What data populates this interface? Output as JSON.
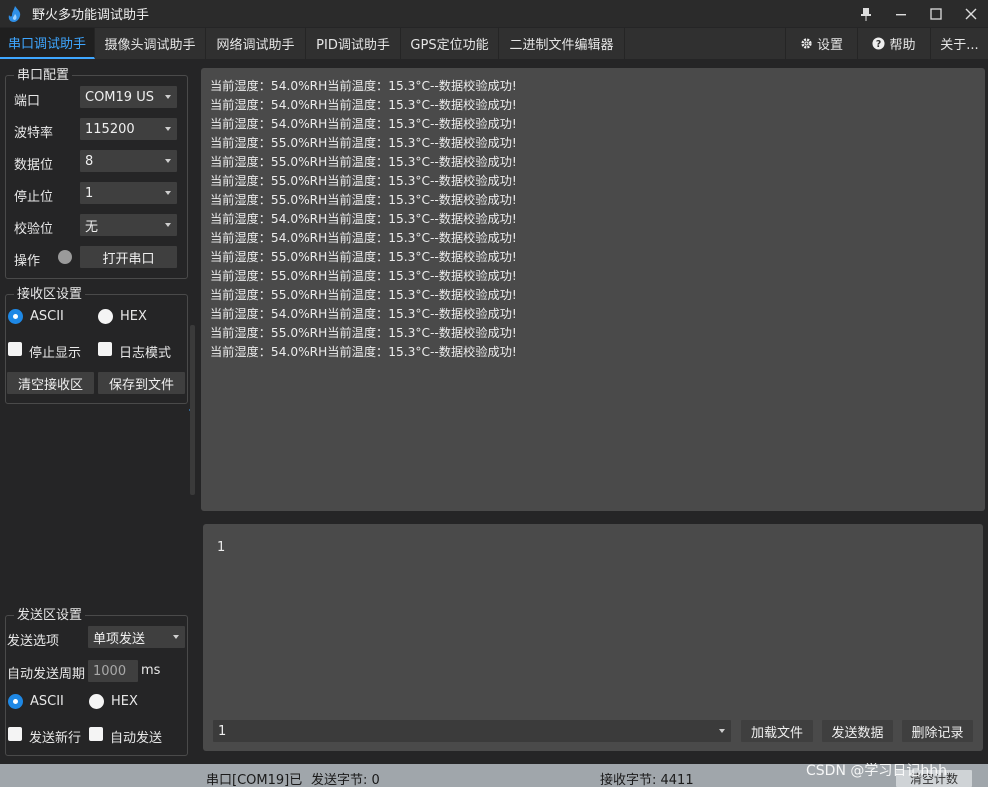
{
  "app": {
    "title": "野火多功能调试助手"
  },
  "window": {
    "pin_icon": "pin-icon",
    "min_icon": "minimize-icon",
    "max_icon": "maximize-icon",
    "close_icon": "close-icon"
  },
  "tabs": [
    {
      "label": "串口调试助手",
      "active": true
    },
    {
      "label": "摄像头调试助手"
    },
    {
      "label": "网络调试助手"
    },
    {
      "label": "PID调试助手"
    },
    {
      "label": "GPS定位功能"
    },
    {
      "label": "二进制文件编辑器"
    }
  ],
  "right_tabs": {
    "settings": "设置",
    "help": "帮助",
    "about": "关于..."
  },
  "serial_config": {
    "title": "串口配置",
    "port_label": "端口",
    "port_value": "COM19 US",
    "baud_label": "波特率",
    "baud_value": "115200",
    "databits_label": "数据位",
    "databits_value": "8",
    "stopbits_label": "停止位",
    "stopbits_value": "1",
    "parity_label": "校验位",
    "parity_value": "无",
    "op_label": "操作",
    "open_button": "打开串口"
  },
  "receive_settings": {
    "title": "接收区设置",
    "ascii": "ASCII",
    "hex": "HEX",
    "stop_display": "停止显示",
    "log_mode": "日志模式",
    "clear_button": "清空接收区",
    "save_button": "保存到文件"
  },
  "receive_lines": [
    "当前湿度：54.0%RH当前温度：15.3°C--数据校验成功!",
    "当前湿度：54.0%RH当前温度：15.3°C--数据校验成功!",
    "当前湿度：54.0%RH当前温度：15.3°C--数据校验成功!",
    "当前湿度：55.0%RH当前温度：15.3°C--数据校验成功!",
    "当前湿度：55.0%RH当前温度：15.3°C--数据校验成功!",
    "当前湿度：55.0%RH当前温度：15.3°C--数据校验成功!",
    "当前湿度：55.0%RH当前温度：15.3°C--数据校验成功!",
    "当前湿度：54.0%RH当前温度：15.3°C--数据校验成功!",
    "当前湿度：54.0%RH当前温度：15.3°C--数据校验成功!",
    "当前湿度：55.0%RH当前温度：15.3°C--数据校验成功!",
    "当前湿度：55.0%RH当前温度：15.3°C--数据校验成功!",
    "当前湿度：55.0%RH当前温度：15.3°C--数据校验成功!",
    "当前湿度：54.0%RH当前温度：15.3°C--数据校验成功!",
    "当前湿度：55.0%RH当前温度：15.3°C--数据校验成功!",
    "当前湿度：54.0%RH当前温度：15.3°C--数据校验成功!"
  ],
  "send_settings": {
    "title": "发送区设置",
    "option_label": "发送选项",
    "option_value": "单项发送",
    "period_label": "自动发送周期",
    "period_value": "1000",
    "period_unit": "ms",
    "ascii": "ASCII",
    "hex": "HEX",
    "newline": "发送新行",
    "auto_send": "自动发送"
  },
  "send_area": {
    "text": "1",
    "combo_value": "1",
    "load_file": "加载文件",
    "send_data": "发送数据",
    "delete_record": "删除记录"
  },
  "status": {
    "port": "串口[COM19]已",
    "sent": "发送字节: 0",
    "received": "接收字节: 4411",
    "clear_count": "清空计数",
    "watermark": "CSDN @学习日记hhh"
  },
  "colors": {
    "accent": "#3ea6ff",
    "radio_on": "#1e88e5"
  }
}
